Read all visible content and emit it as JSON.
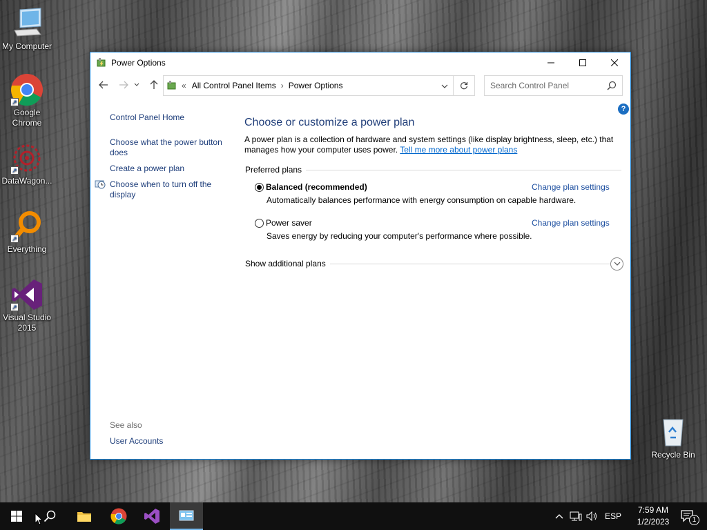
{
  "desktop": {
    "icons": [
      {
        "label": "My Computer"
      },
      {
        "label": "Google Chrome"
      },
      {
        "label": "DataWagon..."
      },
      {
        "label": "Everything"
      },
      {
        "label": "Visual Studio 2015"
      },
      {
        "label": "Recycle Bin"
      }
    ]
  },
  "window": {
    "title": "Power Options",
    "address": {
      "overflow": "«",
      "crumbs": [
        "All Control Panel Items",
        "Power Options"
      ],
      "separator": "›"
    },
    "search_placeholder": "Search Control Panel",
    "left_pane": {
      "home": "Control Panel Home",
      "links": [
        "Choose what the power button does",
        "Create a power plan",
        "Choose when to turn off the display"
      ],
      "see_also": "See also",
      "see_also_links": [
        "User Accounts"
      ]
    },
    "main": {
      "heading": "Choose or customize a power plan",
      "description": "A power plan is a collection of hardware and system settings (like display brightness, sleep, etc.) that manages how your computer uses power.",
      "description_link": "Tell me more about power plans",
      "preferred_label": "Preferred plans",
      "plans": [
        {
          "name": "Balanced (recommended)",
          "selected": true,
          "description": "Automatically balances performance with energy consumption on capable hardware.",
          "link": "Change plan settings"
        },
        {
          "name": "Power saver",
          "selected": false,
          "description": "Saves energy by reducing your computer's performance where possible.",
          "link": "Change plan settings"
        }
      ],
      "show_additional": "Show additional plans",
      "help": "?"
    }
  },
  "taskbar": {
    "language": "ESP",
    "time": "7:59 AM",
    "date": "1/2/2023",
    "notification_count": "1",
    "colors": {
      "background": "#101010",
      "accent": "#76b9ed"
    }
  }
}
